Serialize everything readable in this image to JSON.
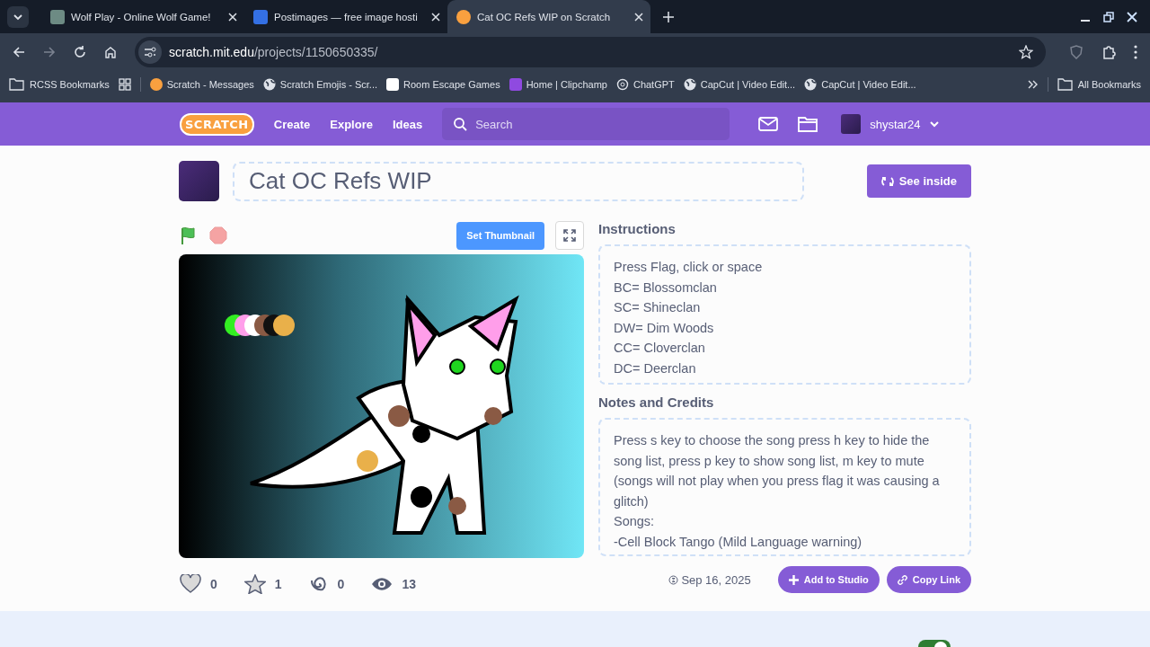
{
  "browser": {
    "tabs": [
      {
        "title": "Wolf Play - Online Wolf Game!",
        "kind": "wp",
        "selected": false
      },
      {
        "title": "Postimages — free image hosti",
        "kind": "p",
        "selected": false
      },
      {
        "title": "Cat OC Refs WIP on Scratch",
        "kind": "s",
        "selected": true
      }
    ],
    "url_host": "scratch.mit.edu",
    "url_path": "/projects/1150650335/",
    "bookmarks": [
      {
        "label": "RCSS Bookmarks",
        "kind": "folder"
      },
      {
        "label": "Scratch - Messages",
        "kind": "s"
      },
      {
        "label": "Scratch Emojis - Scr...",
        "kind": "globe"
      },
      {
        "label": "Room Escape Games",
        "kind": "cube"
      },
      {
        "label": "Home | Clipchamp",
        "kind": "clip"
      },
      {
        "label": "ChatGPT",
        "kind": "gpt"
      },
      {
        "label": "CapCut | Video Edit...",
        "kind": "globe"
      },
      {
        "label": "CapCut | Video Edit...",
        "kind": "globe"
      }
    ],
    "all_bookmarks": "All Bookmarks"
  },
  "nav": {
    "logo": "SCRATCH",
    "links": [
      "Create",
      "Explore",
      "Ideas"
    ],
    "search": {
      "placeholder": "Search"
    },
    "username": "shystar24"
  },
  "project": {
    "title": "Cat OC Refs WIP",
    "see_inside": "See inside",
    "set_thumbnail": "Set Thumbnail",
    "instructions_heading": "Instructions",
    "instructions": [
      "Press Flag, click or space",
      "BC= Blossomclan",
      "SC= Shineclan",
      "DW= Dim Woods",
      "CC= Cloverclan",
      "DC= Deerclan"
    ],
    "notes_heading": "Notes and Credits",
    "notes": [
      "Press s key to choose the song press h key to hide the song list, press p key to show song list, m key to mute (songs will not play when you press flag it was causing a glitch)",
      "Songs:",
      "-Cell Block Tango (Mild Language warning)"
    ],
    "stats": [
      {
        "kind": "love",
        "count": "0"
      },
      {
        "kind": "favorite",
        "count": "1"
      },
      {
        "kind": "remix",
        "count": "0"
      },
      {
        "kind": "views",
        "count": "13"
      }
    ],
    "date": "Sep 16, 2025",
    "add_to_studio": "Add to Studio",
    "copy_link": "Copy Link"
  },
  "comments_toggle": {
    "on": true
  }
}
